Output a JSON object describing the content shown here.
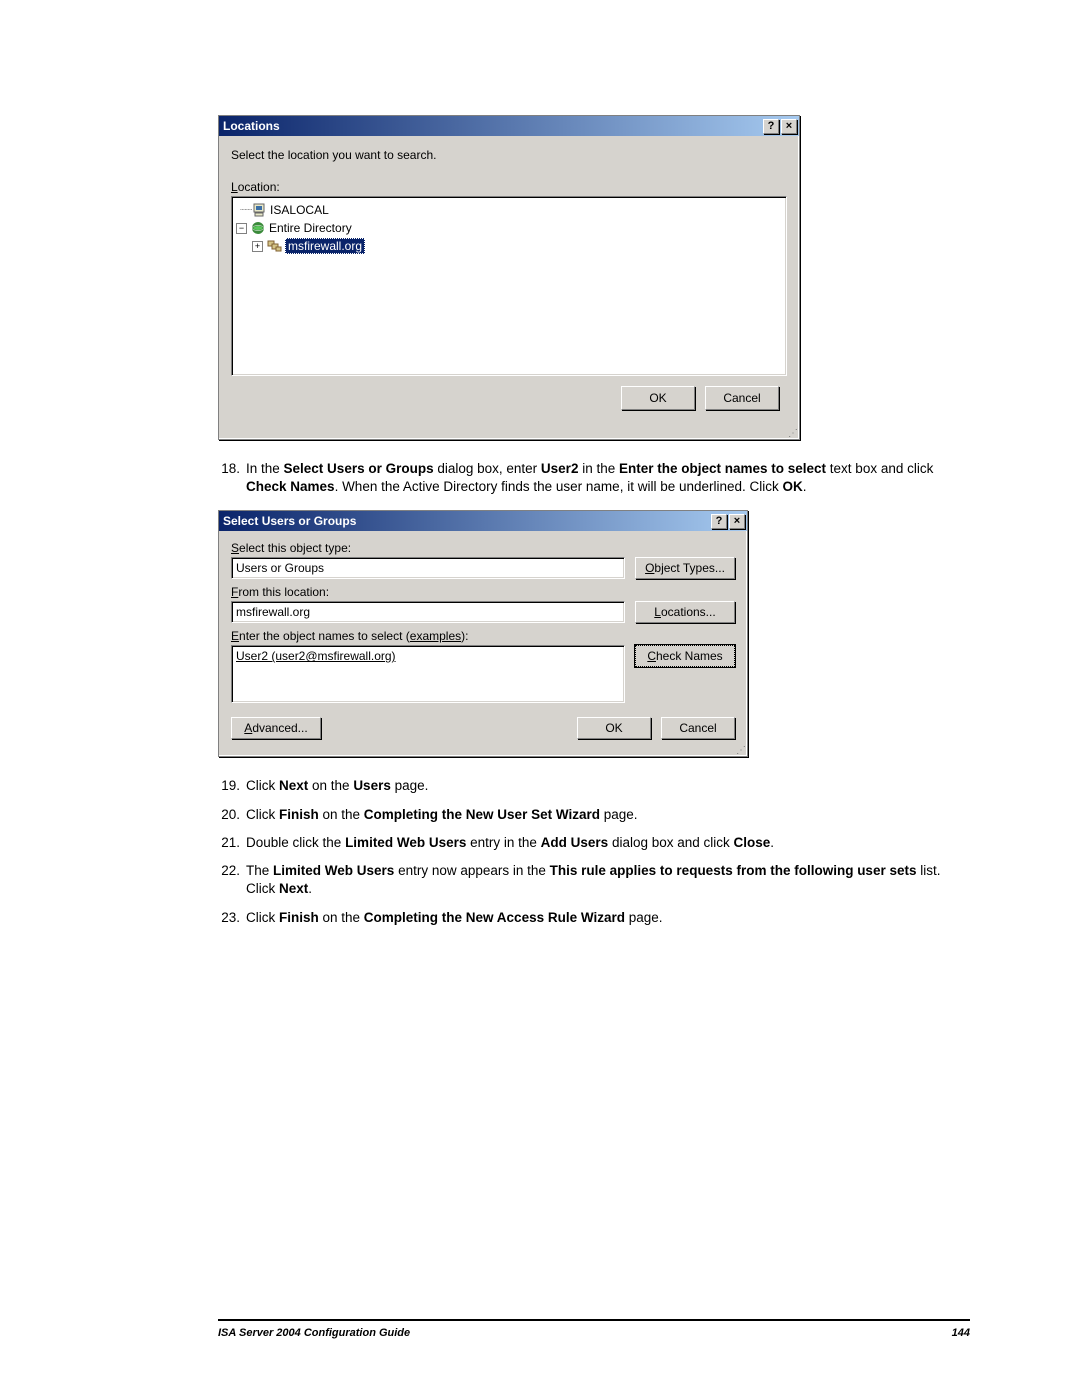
{
  "dialog1": {
    "title": "Locations",
    "helpBtn": "?",
    "closeBtn": "×",
    "instruction": "Select the location you want to search.",
    "locationLabel": "Location:",
    "locationLabelHotkey": "L",
    "tree": {
      "node1": "ISALOCAL",
      "node2": "Entire Directory",
      "node3": "msfirewall.org"
    },
    "ok": "OK",
    "cancel": "Cancel"
  },
  "steps": {
    "s18": {
      "num": "18.",
      "pre": "In the ",
      "b1": "Select Users or Groups",
      "t1": " dialog box, enter ",
      "b2": "User2",
      "t2": " in the ",
      "b3": "Enter the object names to select",
      "t3": " text box and click ",
      "b4": "Check Names",
      "t4": ". When the Active Directory finds the user name, it will be underlined. Click ",
      "b5": "OK",
      "t5": "."
    },
    "s19": {
      "num": "19.",
      "pre": "Click ",
      "b1": "Next",
      "t1": " on the ",
      "b2": "Users",
      "t2": " page."
    },
    "s20": {
      "num": "20.",
      "pre": "Click ",
      "b1": "Finish",
      "t1": " on the ",
      "b2": "Completing the New User Set Wizard",
      "t2": " page."
    },
    "s21": {
      "num": "21.",
      "pre": "Double click the ",
      "b1": "Limited Web Users",
      "t1": " entry in the ",
      "b2": "Add Users",
      "t2": " dialog box and click ",
      "b3": "Close",
      "t3": "."
    },
    "s22": {
      "num": "22.",
      "pre": "The ",
      "b1": "Limited Web Users",
      "t1": " entry now appears in the ",
      "b2": "This rule applies to requests from the following user sets",
      "t2": " list. Click ",
      "b3": "Next",
      "t3": "."
    },
    "s23": {
      "num": "23.",
      "pre": "Click ",
      "b1": "Finish",
      "t1": " on the ",
      "b2": "Completing the New Access Rule Wizard",
      "t2": " page."
    }
  },
  "dialog2": {
    "title": "Select Users or Groups",
    "helpBtn": "?",
    "closeBtn": "×",
    "selectTypeLabelPre": "S",
    "selectTypeLabelHotkey": "S",
    "selectTypeLabel": "elect this object type:",
    "objectTypeValue": "Users or Groups",
    "objectTypesBtn": "bject Types...",
    "objectTypesHotkey": "O",
    "fromLocationHotkey": "F",
    "fromLocationLabel": "rom this location:",
    "locationValue": "msfirewall.org",
    "locationsHotkey": "L",
    "locationsBtn": "ocations...",
    "enterNamesHotkey": "E",
    "enterNamesLabel": "nter the object names to select (",
    "examplesLink": "examples",
    "enterNamesLabelEnd": "):",
    "resolvedName": "User2 (user2@msfirewall.org)",
    "checkNamesHotkey": "C",
    "checkNamesBtn": "heck Names",
    "advancedHotkey": "A",
    "advancedBtn": "dvanced...",
    "ok": "OK",
    "cancel": "Cancel"
  },
  "footer": {
    "title": "ISA Server 2004 Configuration Guide",
    "page": "144"
  }
}
